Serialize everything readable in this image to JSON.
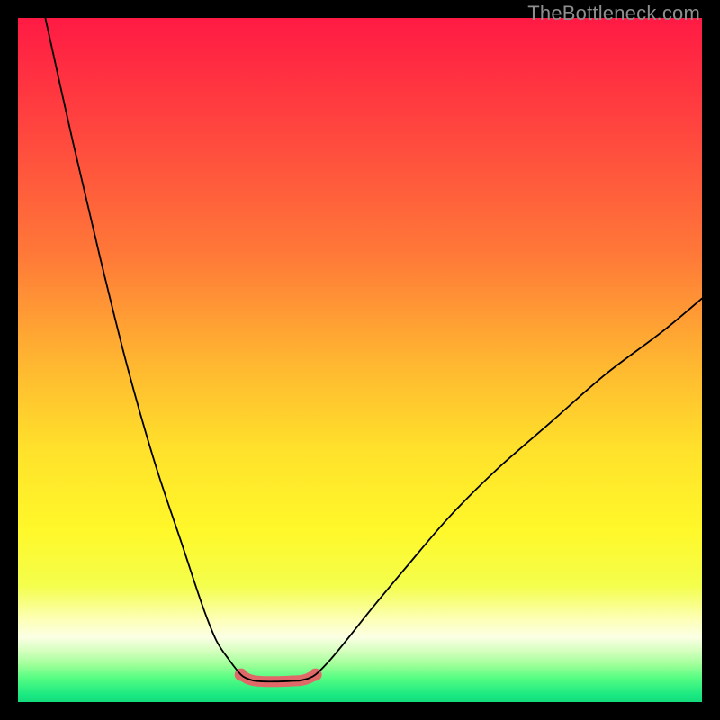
{
  "watermark": "TheBottleneck.com",
  "chart_data": {
    "type": "line",
    "title": "",
    "xlabel": "",
    "ylabel": "",
    "xlim": [
      0,
      100
    ],
    "ylim": [
      0,
      100
    ],
    "series": [
      {
        "name": "left-branch",
        "x": [
          4,
          8,
          12,
          16,
          20,
          24,
          27,
          29,
          31,
          32.6,
          33.6,
          34.4
        ],
        "y": [
          100,
          82,
          65,
          49,
          35,
          23,
          14,
          9,
          6,
          4.0,
          3.4,
          3.15
        ]
      },
      {
        "name": "right-branch",
        "x": [
          41.3,
          42.3,
          43.5,
          45.5,
          48,
          52,
          57,
          63,
          70,
          78,
          86,
          94,
          100
        ],
        "y": [
          3.15,
          3.4,
          4.0,
          6,
          9,
          14,
          20,
          27,
          34,
          41,
          48,
          54,
          59
        ]
      },
      {
        "name": "trough-zone",
        "x": [
          32.6,
          33.6,
          34.4,
          35.2,
          36.2,
          37.6,
          39.5,
          40.5,
          41.3,
          42.3,
          43.5
        ],
        "y": [
          4.0,
          3.4,
          3.15,
          3.05,
          3.0,
          3.0,
          3.05,
          3.1,
          3.15,
          3.4,
          4.0
        ]
      }
    ],
    "gradient_stops": [
      {
        "offset": 0.0,
        "color": "#ff1a44"
      },
      {
        "offset": 0.18,
        "color": "#ff4a3e"
      },
      {
        "offset": 0.35,
        "color": "#ff7a38"
      },
      {
        "offset": 0.5,
        "color": "#ffb531"
      },
      {
        "offset": 0.63,
        "color": "#ffe12b"
      },
      {
        "offset": 0.75,
        "color": "#fff82a"
      },
      {
        "offset": 0.83,
        "color": "#f4fe4c"
      },
      {
        "offset": 0.88,
        "color": "#fdffb8"
      },
      {
        "offset": 0.905,
        "color": "#fbffe4"
      },
      {
        "offset": 0.925,
        "color": "#d6ffbf"
      },
      {
        "offset": 0.945,
        "color": "#a0ff99"
      },
      {
        "offset": 0.965,
        "color": "#55fd82"
      },
      {
        "offset": 0.99,
        "color": "#19e881"
      },
      {
        "offset": 1.0,
        "color": "#14dc7c"
      }
    ],
    "trough_color": "#e06868",
    "trough_stroke_width": 12,
    "curve_stroke_width": 1.8
  }
}
